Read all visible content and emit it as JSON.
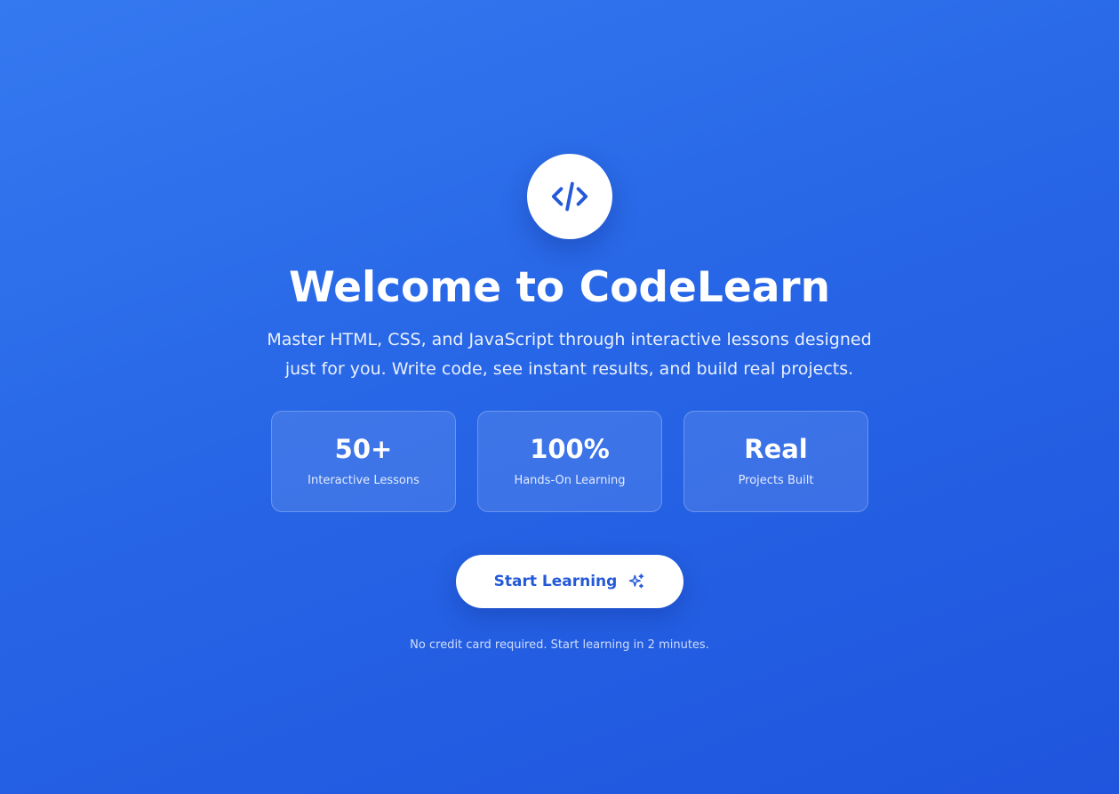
{
  "logo": {
    "icon": "code-icon"
  },
  "hero": {
    "title": "Welcome to CodeLearn",
    "subtitle": "Master HTML, CSS, and JavaScript through interactive lessons designed just for you. Write code, see instant results, and build real projects."
  },
  "stats": [
    {
      "value": "50+",
      "label": "Interactive Lessons"
    },
    {
      "value": "100%",
      "label": "Hands-On Learning"
    },
    {
      "value": "Real",
      "label": "Projects Built"
    }
  ],
  "cta": {
    "label": "Start Learning",
    "icon": "sparkles-icon"
  },
  "footnote": "No credit card required. Start learning in 2 minutes.",
  "colors": {
    "background_start": "#3579f0",
    "background_end": "#1f55de",
    "accent": "#2459d8",
    "text": "#ffffff"
  }
}
